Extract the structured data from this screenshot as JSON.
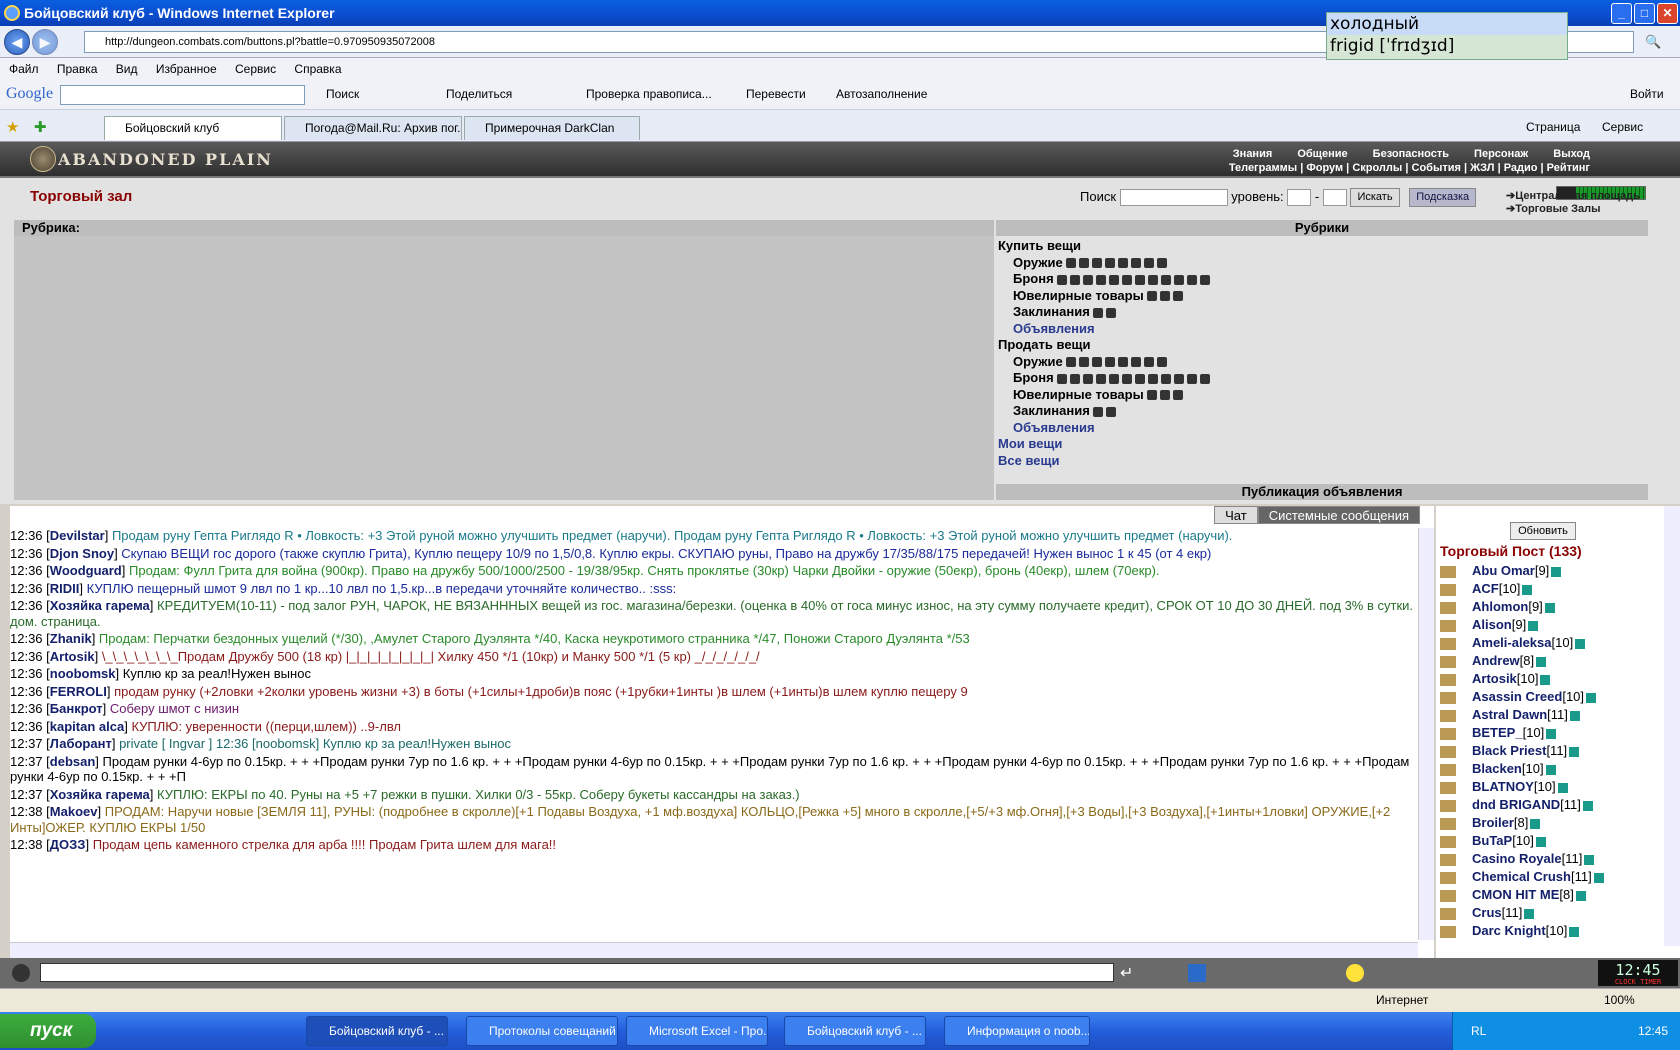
{
  "window": {
    "title": "Бойцовский клуб - Windows Internet Explorer"
  },
  "dictionary_popup": {
    "word": "холодный",
    "translation": "frigid [ˈfrɪdʒɪd]"
  },
  "address": {
    "url": "http://dungeon.combats.com/buttons.pl?battle=0.970950935072008"
  },
  "menu": [
    "Файл",
    "Правка",
    "Вид",
    "Избранное",
    "Сервис",
    "Справка"
  ],
  "google_toolbar": {
    "logo": "Google",
    "items": [
      "Поиск",
      "Поделиться",
      "Проверка правописа...",
      "Перевести",
      "Автозаполнение",
      "Войти"
    ]
  },
  "tabs": [
    "Бойцовский клуб",
    "Погода@Mail.Ru: Архив пог...",
    "Примерочная DarkClan"
  ],
  "ie_tools": [
    "Страница",
    "Сервис"
  ],
  "game": {
    "logo_text": "ABANDONED PLAIN",
    "nav1": [
      "Знания",
      "Общение",
      "Безопасность",
      "Персонаж",
      "Выход"
    ],
    "nav2": "Телеграммы | Форум | Скроллы | События | ЖЗЛ | Радио | Рейтинг",
    "room_title": "Торговый зал",
    "search_label": "Поиск",
    "level_label": "уровень:",
    "search_button": "Искать",
    "hint_button": "Подсказка",
    "right_links": [
      "Центральная площадь",
      "Торговые Залы"
    ],
    "rubrika_label": "Рубрика:",
    "rubriki_label": "Рубрики",
    "publish_label": "Публикация объявления",
    "catalog": {
      "buy": "Купить вещи",
      "sell": "Продать вещи",
      "weapons": "Оружие",
      "armor": "Броня",
      "jewelry": "Ювелирные товары",
      "spells": "Заклинания",
      "ads": "Объявления",
      "my_items": "Мои вещи",
      "all_items": "Все вещи"
    }
  },
  "chat": {
    "tabs": [
      "Чат",
      "Системные сообщения"
    ],
    "messages": [
      {
        "time": "12:36",
        "nick": "Devilstar",
        "text": "Продам руну Гепта Риглядо R • Ловкость: +3 Этой руной можно улучшить предмет (наручи). Продам руну Гепта Риглядо R • Ловкость: +3 Этой руной можно улучшить предмет (наручи).",
        "color": "#1a7a8a"
      },
      {
        "time": "12:36",
        "nick": "Djon Snoy",
        "text": "Скупаю ВЕЩИ гос дорого (также скуплю Грита), Куплю пещеру 10/9 по 1,5/0,8. Куплю екры. СКУПАЮ руны, Право на дружбу 17/35/88/175 передачей! Нужен вынос 1 к 45 (от 4 екр)",
        "color": "#1a2a9a"
      },
      {
        "time": "12:36",
        "nick": "Woodguard",
        "text": "Продам: Фулл Грита для война (900кр). Право на дружбу 500/1000/2500 - 19/38/95кр. Снять проклятье (30кр) Чарки Двойки - оружие (50екр), бронь (40екр), шлем (70екр).",
        "color": "#2a8a2a"
      },
      {
        "time": "12:36",
        "nick": "RIDII",
        "text": "КУПЛЮ пещерный шмот 9 лвл по 1 кр...10 лвл по 1,5.кр...в передачи уточняйте количество.. :sss:",
        "color": "#1a2a9a"
      },
      {
        "time": "12:36",
        "nick": "Хозяйка гарема",
        "text": "КРЕДИТУЕМ(10-11) - под залог РУН, ЧАРОК, НЕ ВЯЗАНННЫХ вещей из гос. магазина/березки. (оценка в 40% от госа минус износ, на эту сумму получаете кредит), СРОК ОТ 10 ДО 30 ДНЕЙ. под 3% в сутки. дом. страница.",
        "color": "#2a6a2a"
      },
      {
        "time": "12:36",
        "nick": "Zhanik",
        "text": "Продам: Перчатки бездонных ущелий (*/30), ,Амулет Старого Дуэлянта */40, Каска неукротимого странника */47, Поножи Старого Дуэлянта */53",
        "color": "#2a8a2a"
      },
      {
        "time": "12:36",
        "nick": "Artosik",
        "text": "\\_\\_\\_\\_\\_\\_\\_Продам Дружбу 500 (18 кр) |_|_|_|_|_|_|_|_| Хилку 450 */1 (10кр) и Манку 500 */1 (5 кр) _/_/_/_/_/_/",
        "color": "#8a1a1a"
      },
      {
        "time": "12:36",
        "nick": "noobomsk",
        "text": "Куплю кр за реал!Нужен вынос",
        "color": "#000"
      },
      {
        "time": "12:36",
        "nick": "FERROLI",
        "text": "продам рунку (+2ловки +2колки уровень жизни +3) в боты (+1силы+1дроби)в пояс (+1рубки+1инты )в шлем (+1инты)в шлем куплю пещеру 9",
        "color": "#8a1a1a"
      },
      {
        "time": "12:36",
        "nick": "Банкрот",
        "text": "Соберу шмот с низин",
        "color": "#6a1a6a"
      },
      {
        "time": "12:36",
        "nick": "kapitan alca",
        "text": "КУПЛЮ: уверенности ((перци,шлем)) ..9-лвл",
        "color": "#8a1a1a"
      },
      {
        "time": "12:37",
        "nick": "Лаборант",
        "text": "private [ Ingvar ] 12:36 [noobomsk] Куплю кр за реал!Нужен вынос",
        "color": "#1a6a6a"
      },
      {
        "time": "12:37",
        "nick": "debsan",
        "text": "Продам рунки 4-6ур по 0.15кр. + + +Продам рунки 7ур по 1.6 кр. + + +Продам рунки 4-6ур по 0.15кр. + + +Продам рунки 7ур по 1.6 кр. + + +Продам рунки 4-6ур по 0.15кр. + + +Продам рунки 7ур по 1.6 кр. + + +Продам рунки 4-6ур по 0.15кр. + + +П",
        "color": "#000"
      },
      {
        "time": "12:37",
        "nick": "Хозяйка гарема",
        "text": "КУПЛЮ: ЕКРЫ по 40. Руны на +5 +7 режки в пушки. Хилки 0/3 - 55кр. Соберу букеты кассандры на заказ.)",
        "color": "#2a6a2a"
      },
      {
        "time": "12:38",
        "nick": "Makoev",
        "text": "ПРОДАМ: Наручи новые [ЗЕМЛЯ 11], РУНЫ: (подробнее в скролле)[+1 Подавы Воздуха, +1 мф.воздуха] КОЛЬЦО,[Режка +5] много в скролле,[+5/+3 мф.Огня],[+3 Воды],[+3 Воздуха],[+1инты+1ловки] ОРУЖИЕ,[+2 Инты]ОЖЕР. КУПЛЮ ЕКРЫ 1/50",
        "color": "#8a6a1a"
      },
      {
        "time": "12:38",
        "nick": "ДОЗЗ",
        "text": "Продам цепь каменного стрелка для арба !!!! Продам Грита шлем для мага!!",
        "color": "#8a1a1a"
      }
    ]
  },
  "users_panel": {
    "refresh": "Обновить",
    "title": "Торговый Пост (133)",
    "users": [
      {
        "name": "Abu Omar",
        "level": "[9]"
      },
      {
        "name": "ACF",
        "level": "[10]"
      },
      {
        "name": "Ahlomon",
        "level": "[9]"
      },
      {
        "name": "Alison",
        "level": "[9]"
      },
      {
        "name": "Ameli-aleksa",
        "level": "[10]"
      },
      {
        "name": "Andrew",
        "level": "[8]"
      },
      {
        "name": "Artosik",
        "level": "[10]"
      },
      {
        "name": "Asassin Creed",
        "level": "[10]"
      },
      {
        "name": "Astral Dawn",
        "level": "[11]"
      },
      {
        "name": "BETEP_",
        "level": "[10]"
      },
      {
        "name": "Black Priest",
        "level": "[11]"
      },
      {
        "name": "Blacken",
        "level": "[10]"
      },
      {
        "name": "BLATNOY",
        "level": "[10]"
      },
      {
        "name": "dnd BRIGAND",
        "level": "[11]"
      },
      {
        "name": "Broiler",
        "level": "[8]"
      },
      {
        "name": "BuTaP",
        "level": "[10]"
      },
      {
        "name": "Casino Royale",
        "level": "[11]"
      },
      {
        "name": "Chemical Crush",
        "level": "[11]"
      },
      {
        "name": "CMON HIT ME",
        "level": "[8]"
      },
      {
        "name": "Crus",
        "level": "[11]"
      },
      {
        "name": "Darc Knight",
        "level": "[10]"
      }
    ]
  },
  "clock": {
    "time": "12:45",
    "label": "CLOCK TIMER"
  },
  "statusbar": {
    "zone": "Интернет",
    "zoom": "100%"
  },
  "taskbar": {
    "start": "пуск",
    "tasks": [
      "Бойцовский клуб - ...",
      "Протоколы совещаний",
      "Microsoft Excel - Про...",
      "Бойцовский клуб - ...",
      "Информация о noob..."
    ],
    "lang": "RL",
    "time": "12:45"
  }
}
